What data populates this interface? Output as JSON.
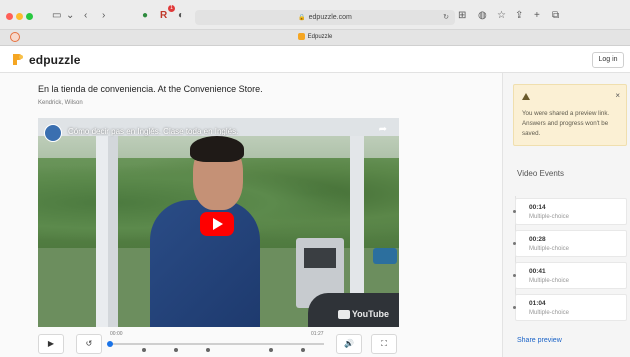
{
  "browser": {
    "url": "edpuzzle.com",
    "tab_title": "Edpuzzle",
    "extension_badge": "1"
  },
  "site": {
    "logo_text": "edpuzzle",
    "login_label": "Log in"
  },
  "video": {
    "title": "En la tienda de conveniencia. At the Convenience Store.",
    "author": "Kendrick, Wilson",
    "youtube_title": "Cómo decir pas en Inglés. Clase toda en Inglés.",
    "youtube_brand": "YouTube",
    "time_start": "00:00",
    "time_end": "01:27",
    "progress_fraction": 0.0,
    "question_markers": [
      0.16,
      0.31,
      0.46,
      0.75,
      0.9
    ]
  },
  "sidebar": {
    "notice": "You were shared a preview link. Answers and progress won't be saved.",
    "close_symbol": "×",
    "events_title": "Video Events",
    "events": [
      {
        "time": "00:14",
        "type": "Multiple-choice"
      },
      {
        "time": "00:28",
        "type": "Multiple-choice"
      },
      {
        "time": "00:41",
        "type": "Multiple-choice"
      },
      {
        "time": "01:04",
        "type": "Multiple-choice"
      }
    ],
    "share_preview_label": "Share preview"
  },
  "colors": {
    "accent": "#1a63c7",
    "youtube_red": "#ff0000",
    "notice_bg": "#fbf0d4"
  }
}
